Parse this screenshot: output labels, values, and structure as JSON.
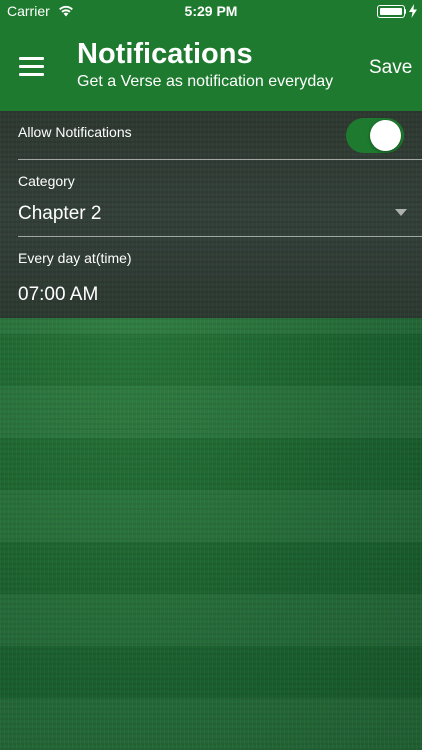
{
  "status_bar": {
    "carrier": "Carrier",
    "time": "5:29 PM",
    "icons": [
      "wifi-icon",
      "battery-icon",
      "charging-bolt-icon"
    ]
  },
  "nav": {
    "title": "Notifications",
    "subtitle": "Get a Verse as notification everyday",
    "save_label": "Save",
    "menu_icon": "hamburger-menu-icon"
  },
  "settings": {
    "allow_notifications": {
      "label": "Allow Notifications",
      "enabled": true
    },
    "category": {
      "label": "Category",
      "value": "Chapter 2",
      "icon": "dropdown-triangle-icon"
    },
    "time": {
      "label": "Every day at(time)",
      "value": "07:00 AM"
    }
  },
  "colors": {
    "accent_green": "#1e7a2e",
    "panel_dark": "#2f3a33",
    "text": "#ffffff"
  }
}
